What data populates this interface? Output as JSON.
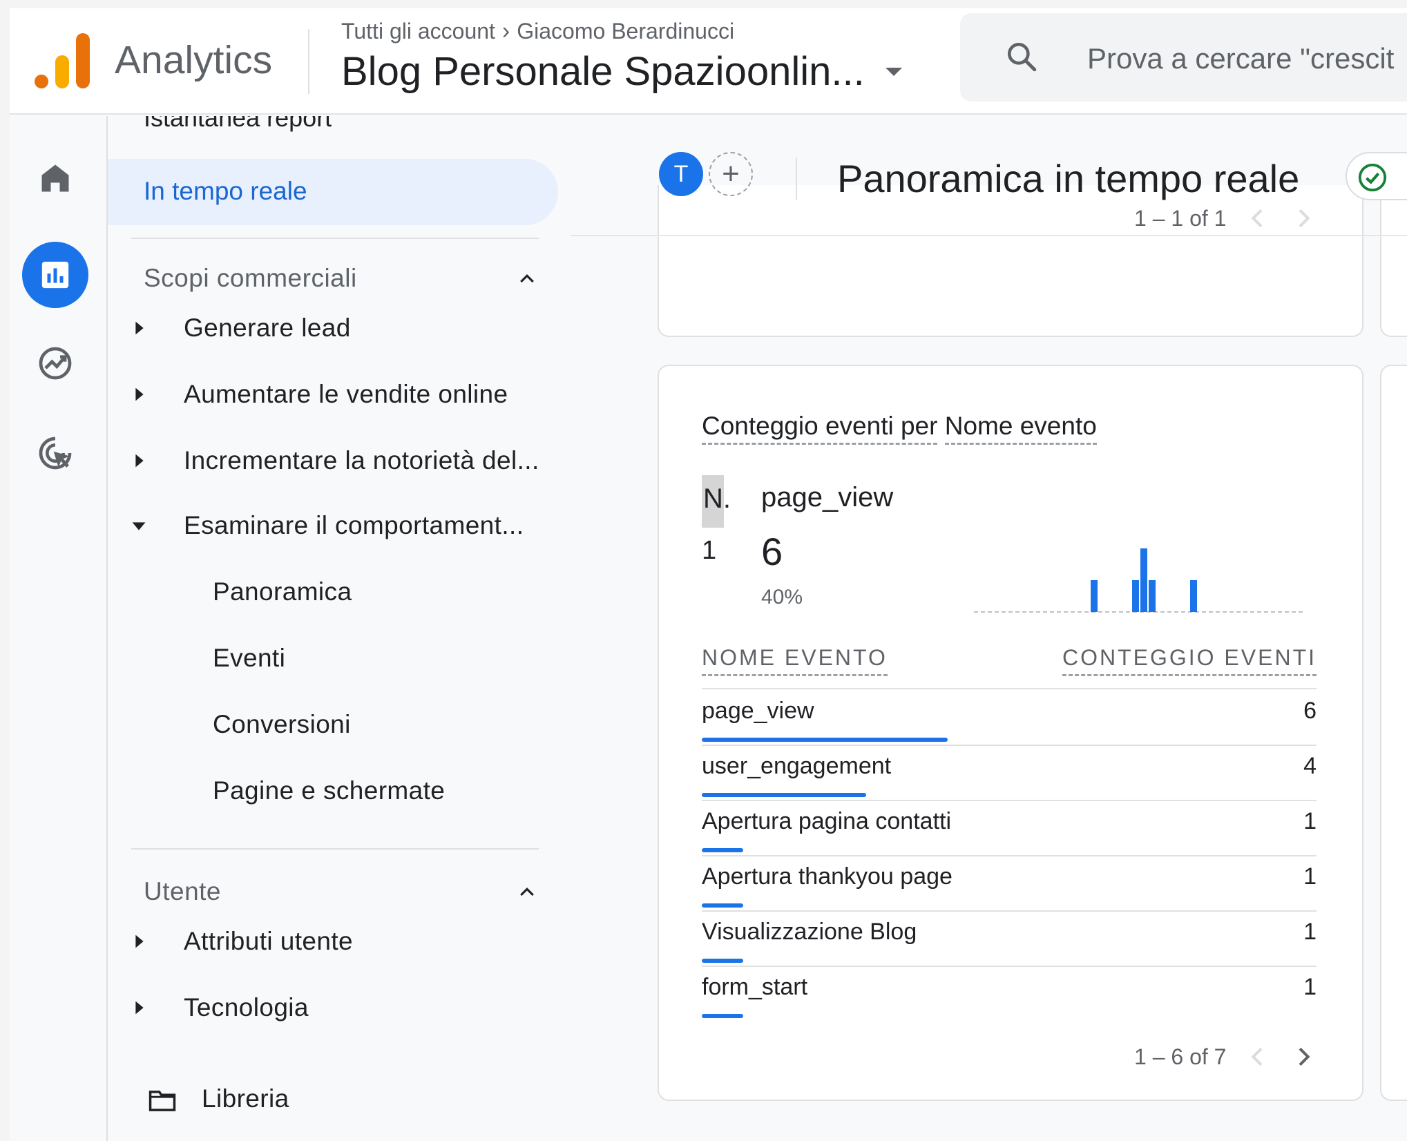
{
  "header": {
    "app_name": "Analytics",
    "breadcrumb": [
      "Tutti gli account",
      "Giacomo Berardinucci"
    ],
    "property_name": "Blog Personale Spazioonlin...",
    "search_placeholder": "Prova a cercare \"crescit"
  },
  "rail": {
    "items": [
      "home-icon",
      "reports-icon",
      "explore-icon",
      "advertising-icon"
    ],
    "active": "reports-icon"
  },
  "sidebar": {
    "top_partial": "Istantanea report",
    "realtime": "In tempo reale",
    "sections": [
      {
        "title": "Scopi commerciali",
        "items": [
          {
            "label": "Generare lead",
            "expanded": false
          },
          {
            "label": "Aumentare le vendite online",
            "expanded": false
          },
          {
            "label": "Incrementare la notorietà del...",
            "expanded": false
          },
          {
            "label": "Esaminare il comportament...",
            "expanded": true
          }
        ],
        "subitems": [
          "Panoramica",
          "Eventi",
          "Conversioni",
          "Pagine e schermate"
        ]
      },
      {
        "title": "Utente",
        "items": [
          {
            "label": "Attributi utente",
            "expanded": false
          },
          {
            "label": "Tecnologia",
            "expanded": false
          }
        ]
      }
    ],
    "library": "Libreria"
  },
  "toolbar": {
    "avatar_letter": "T",
    "add_label": "+",
    "page_title": "Panoramica in tempo reale"
  },
  "top_card": {
    "pager": "1 – 1 of 1"
  },
  "events_card": {
    "title_part1": "Conteggio eventi per",
    "title_part2": "Nome evento",
    "rank_header": "N.",
    "top_event_name": "page_view",
    "top_rank": "1",
    "top_value": "6",
    "top_percent": "40%",
    "sparkline": [
      0,
      0,
      0,
      0,
      0,
      0,
      0,
      0,
      0,
      0,
      0,
      0,
      0,
      0,
      1,
      0,
      0,
      0,
      0,
      1,
      2,
      1,
      0,
      0,
      0,
      0,
      1,
      0,
      0,
      0,
      0,
      0,
      0,
      0,
      0,
      0,
      0,
      0,
      0,
      0
    ],
    "col_name": "NOME EVENTO",
    "col_count": "CONTEGGIO EVENTI",
    "rows": [
      {
        "name": "page_view",
        "count": "6",
        "share": 0.4
      },
      {
        "name": "user_engagement",
        "count": "4",
        "share": 0.267
      },
      {
        "name": "Apertura pagina contatti",
        "count": "1",
        "share": 0.067
      },
      {
        "name": "Apertura thankyou page",
        "count": "1",
        "share": 0.067
      },
      {
        "name": "Visualizzazione Blog",
        "count": "1",
        "share": 0.067
      },
      {
        "name": "form_start",
        "count": "1",
        "share": 0.067
      }
    ],
    "pager": "1 – 6 of 7"
  },
  "colors": {
    "accent": "#1a73e8",
    "active_nav_bg": "#e8f0fe",
    "active_nav_text": "#1967d2",
    "success": "#188038"
  }
}
